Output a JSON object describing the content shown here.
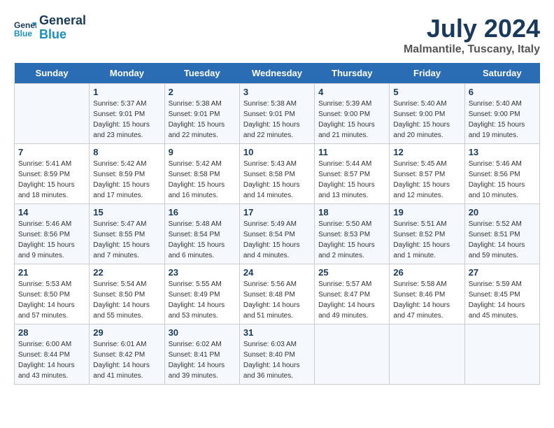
{
  "header": {
    "logo_line1": "General",
    "logo_line2": "Blue",
    "month_title": "July 2024",
    "location": "Malmantile, Tuscany, Italy"
  },
  "days_of_week": [
    "Sunday",
    "Monday",
    "Tuesday",
    "Wednesday",
    "Thursday",
    "Friday",
    "Saturday"
  ],
  "weeks": [
    [
      {
        "day": "",
        "info": ""
      },
      {
        "day": "1",
        "info": "Sunrise: 5:37 AM\nSunset: 9:01 PM\nDaylight: 15 hours\nand 23 minutes."
      },
      {
        "day": "2",
        "info": "Sunrise: 5:38 AM\nSunset: 9:01 PM\nDaylight: 15 hours\nand 22 minutes."
      },
      {
        "day": "3",
        "info": "Sunrise: 5:38 AM\nSunset: 9:01 PM\nDaylight: 15 hours\nand 22 minutes."
      },
      {
        "day": "4",
        "info": "Sunrise: 5:39 AM\nSunset: 9:00 PM\nDaylight: 15 hours\nand 21 minutes."
      },
      {
        "day": "5",
        "info": "Sunrise: 5:40 AM\nSunset: 9:00 PM\nDaylight: 15 hours\nand 20 minutes."
      },
      {
        "day": "6",
        "info": "Sunrise: 5:40 AM\nSunset: 9:00 PM\nDaylight: 15 hours\nand 19 minutes."
      }
    ],
    [
      {
        "day": "7",
        "info": "Sunrise: 5:41 AM\nSunset: 8:59 PM\nDaylight: 15 hours\nand 18 minutes."
      },
      {
        "day": "8",
        "info": "Sunrise: 5:42 AM\nSunset: 8:59 PM\nDaylight: 15 hours\nand 17 minutes."
      },
      {
        "day": "9",
        "info": "Sunrise: 5:42 AM\nSunset: 8:58 PM\nDaylight: 15 hours\nand 16 minutes."
      },
      {
        "day": "10",
        "info": "Sunrise: 5:43 AM\nSunset: 8:58 PM\nDaylight: 15 hours\nand 14 minutes."
      },
      {
        "day": "11",
        "info": "Sunrise: 5:44 AM\nSunset: 8:57 PM\nDaylight: 15 hours\nand 13 minutes."
      },
      {
        "day": "12",
        "info": "Sunrise: 5:45 AM\nSunset: 8:57 PM\nDaylight: 15 hours\nand 12 minutes."
      },
      {
        "day": "13",
        "info": "Sunrise: 5:46 AM\nSunset: 8:56 PM\nDaylight: 15 hours\nand 10 minutes."
      }
    ],
    [
      {
        "day": "14",
        "info": "Sunrise: 5:46 AM\nSunset: 8:56 PM\nDaylight: 15 hours\nand 9 minutes."
      },
      {
        "day": "15",
        "info": "Sunrise: 5:47 AM\nSunset: 8:55 PM\nDaylight: 15 hours\nand 7 minutes."
      },
      {
        "day": "16",
        "info": "Sunrise: 5:48 AM\nSunset: 8:54 PM\nDaylight: 15 hours\nand 6 minutes."
      },
      {
        "day": "17",
        "info": "Sunrise: 5:49 AM\nSunset: 8:54 PM\nDaylight: 15 hours\nand 4 minutes."
      },
      {
        "day": "18",
        "info": "Sunrise: 5:50 AM\nSunset: 8:53 PM\nDaylight: 15 hours\nand 2 minutes."
      },
      {
        "day": "19",
        "info": "Sunrise: 5:51 AM\nSunset: 8:52 PM\nDaylight: 15 hours\nand 1 minute."
      },
      {
        "day": "20",
        "info": "Sunrise: 5:52 AM\nSunset: 8:51 PM\nDaylight: 14 hours\nand 59 minutes."
      }
    ],
    [
      {
        "day": "21",
        "info": "Sunrise: 5:53 AM\nSunset: 8:50 PM\nDaylight: 14 hours\nand 57 minutes."
      },
      {
        "day": "22",
        "info": "Sunrise: 5:54 AM\nSunset: 8:50 PM\nDaylight: 14 hours\nand 55 minutes."
      },
      {
        "day": "23",
        "info": "Sunrise: 5:55 AM\nSunset: 8:49 PM\nDaylight: 14 hours\nand 53 minutes."
      },
      {
        "day": "24",
        "info": "Sunrise: 5:56 AM\nSunset: 8:48 PM\nDaylight: 14 hours\nand 51 minutes."
      },
      {
        "day": "25",
        "info": "Sunrise: 5:57 AM\nSunset: 8:47 PM\nDaylight: 14 hours\nand 49 minutes."
      },
      {
        "day": "26",
        "info": "Sunrise: 5:58 AM\nSunset: 8:46 PM\nDaylight: 14 hours\nand 47 minutes."
      },
      {
        "day": "27",
        "info": "Sunrise: 5:59 AM\nSunset: 8:45 PM\nDaylight: 14 hours\nand 45 minutes."
      }
    ],
    [
      {
        "day": "28",
        "info": "Sunrise: 6:00 AM\nSunset: 8:44 PM\nDaylight: 14 hours\nand 43 minutes."
      },
      {
        "day": "29",
        "info": "Sunrise: 6:01 AM\nSunset: 8:42 PM\nDaylight: 14 hours\nand 41 minutes."
      },
      {
        "day": "30",
        "info": "Sunrise: 6:02 AM\nSunset: 8:41 PM\nDaylight: 14 hours\nand 39 minutes."
      },
      {
        "day": "31",
        "info": "Sunrise: 6:03 AM\nSunset: 8:40 PM\nDaylight: 14 hours\nand 36 minutes."
      },
      {
        "day": "",
        "info": ""
      },
      {
        "day": "",
        "info": ""
      },
      {
        "day": "",
        "info": ""
      }
    ]
  ]
}
